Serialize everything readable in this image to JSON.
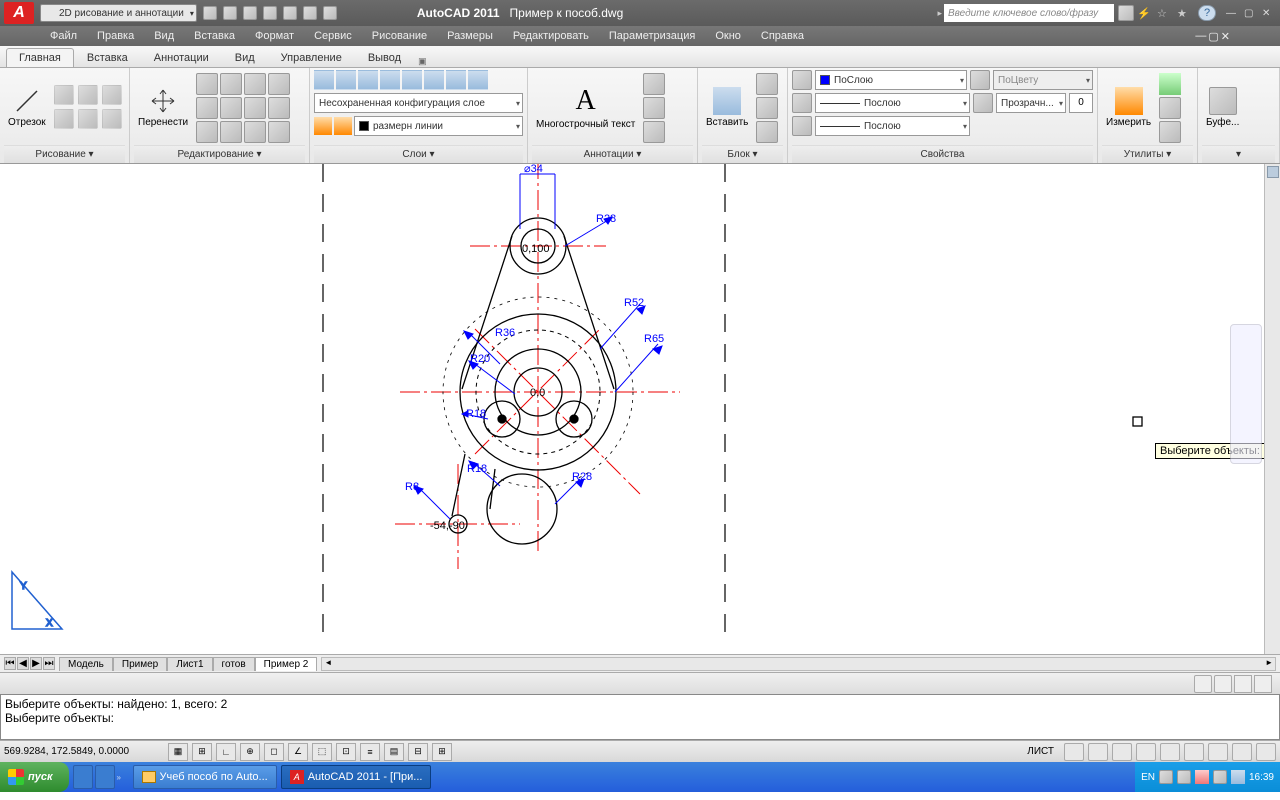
{
  "title": {
    "app": "AutoCAD 2011",
    "doc": "Пример к пособ.dwg"
  },
  "workspace": "2D рисование и аннотации",
  "search_placeholder": "Введите ключевое слово/фразу",
  "menu": [
    "Файл",
    "Правка",
    "Вид",
    "Вставка",
    "Формат",
    "Сервис",
    "Рисование",
    "Размеры",
    "Редактировать",
    "Параметризация",
    "Окно",
    "Справка"
  ],
  "tabs": [
    "Главная",
    "Вставка",
    "Аннотации",
    "Вид",
    "Управление",
    "Вывод"
  ],
  "panels": {
    "draw": {
      "title": "Рисование",
      "line": "Отрезок"
    },
    "edit": {
      "title": "Редактирование",
      "move": "Перенести"
    },
    "layers": {
      "title": "Слои",
      "combo1": "Несохраненная конфигурация слое",
      "combo2": "размерн линии"
    },
    "annot": {
      "title": "Аннотации",
      "mtext": "Многострочный текст",
      "mtext_letter": "А"
    },
    "block": {
      "title": "Блок",
      "insert": "Вставить"
    },
    "props": {
      "title": "Свойства",
      "bylayer": "ПоСлою",
      "bylayer2": "Послою",
      "bylayer3": "Послою",
      "bycolor": "ПоЦвету",
      "transp": "Прозрачн...",
      "transp_val": "0"
    },
    "util": {
      "title": "Утилиты",
      "measure": "Измерить"
    },
    "clip": {
      "title": "",
      "clip": "Буфе..."
    }
  },
  "drawing": {
    "dims": [
      "⌀34",
      "R28",
      "R52",
      "R36",
      "R65",
      "R20",
      "R18",
      "R8",
      "R18",
      "R28"
    ],
    "coords": [
      "0,100",
      "0,0",
      "-54,-90"
    ]
  },
  "tooltip": "Выберите объекты:",
  "layout_tabs": [
    "Модель",
    "Пример",
    "Лист1",
    "готов",
    "Пример 2"
  ],
  "cmd": {
    "line1": "Выберите объекты: найдено: 1, всего: 2",
    "line2": "",
    "line3": "Выберите объекты:"
  },
  "status": {
    "coords": "569.9284, 172.5849, 0.0000",
    "layout": "ЛИСТ"
  },
  "task": {
    "start": "пуск",
    "btn1": "Учеб пособ по Auto...",
    "btn2": "AutoCAD 2011 - [При...",
    "lang": "EN",
    "time": "16:39"
  }
}
